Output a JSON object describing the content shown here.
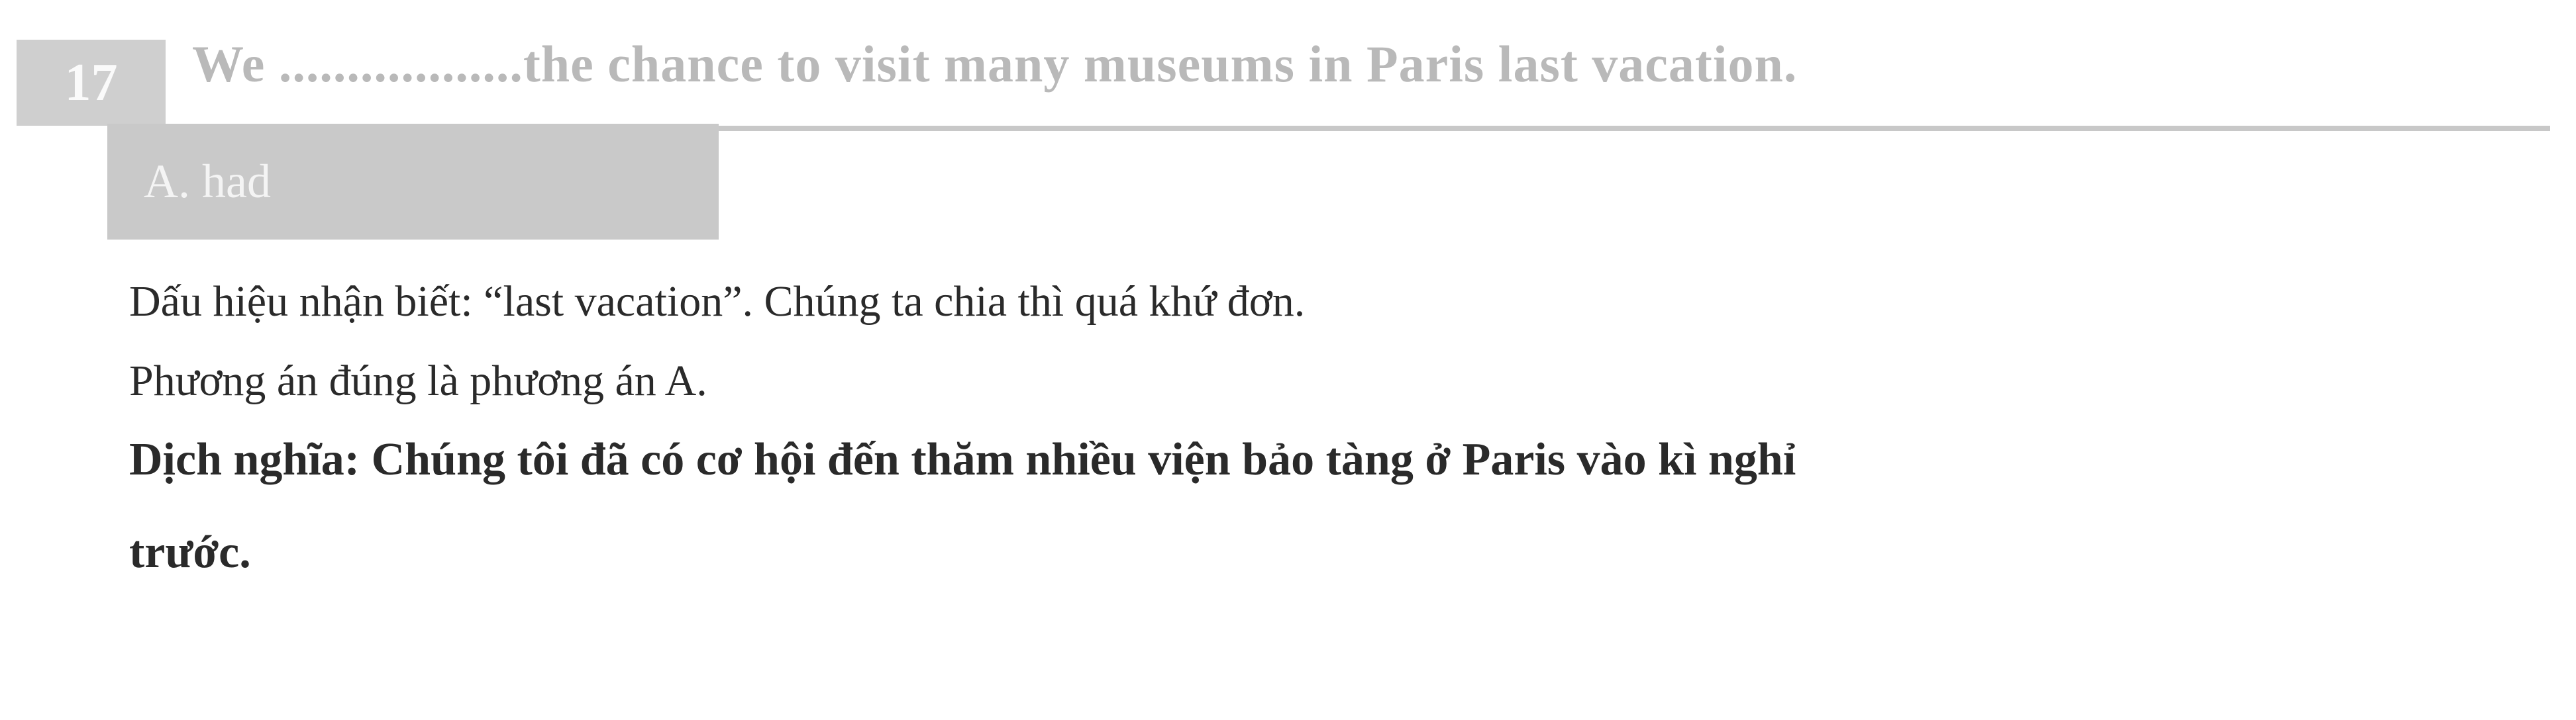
{
  "question": {
    "number": "17",
    "text": "We ..................the chance to visit many museums in Paris last vacation.",
    "answer": "A. had"
  },
  "explanation": {
    "line1": "Dấu hiệu nhận biết: “last vacation”. Chúng ta chia thì quá khứ đơn.",
    "line2": "Phương án đúng là phương án A.",
    "translation_line1": "Dịch nghĩa: Chúng tôi đã có cơ hội đến thăm nhiều viện bảo tàng ở Paris vào kì nghỉ",
    "translation_line2": "trước."
  }
}
